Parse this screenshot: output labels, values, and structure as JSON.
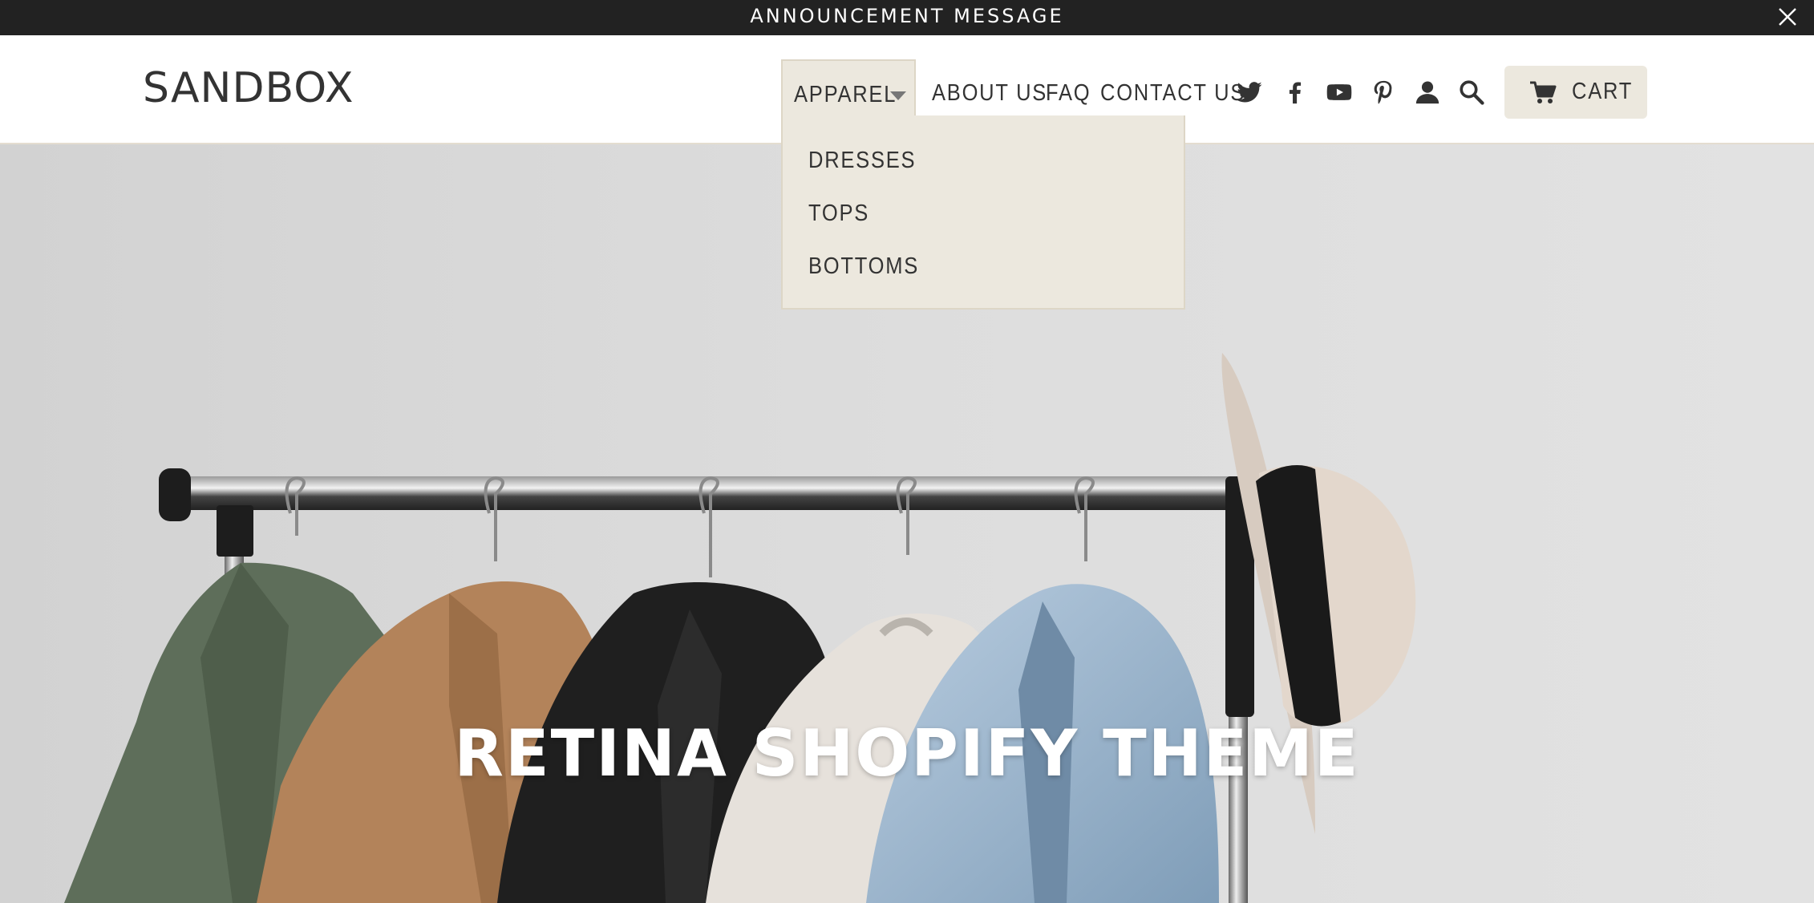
{
  "announcement": {
    "text": "ANNOUNCEMENT MESSAGE",
    "close_icon": "close-icon"
  },
  "header": {
    "logo": "SANDBOX",
    "nav": {
      "apparel": "APPAREL",
      "about": "ABOUT US",
      "faq": "FAQ",
      "contact": "CONTACT US"
    },
    "social_icons": [
      "twitter-icon",
      "facebook-icon",
      "youtube-icon",
      "pinterest-icon"
    ],
    "utility_icons": [
      "account-icon",
      "search-icon"
    ],
    "cart": {
      "label": "CART",
      "icon": "cart-icon"
    }
  },
  "apparel_menu": {
    "items": [
      {
        "label": "DRESSES"
      },
      {
        "label": "TOPS"
      },
      {
        "label": "BOTTOMS"
      }
    ]
  },
  "hero": {
    "title": "RETINA SHOPIFY THEME"
  },
  "colors": {
    "announcement_bg": "#222222",
    "menu_bg": "#ece8de",
    "text": "#333333",
    "hero_bg": "#d9d9d9"
  }
}
